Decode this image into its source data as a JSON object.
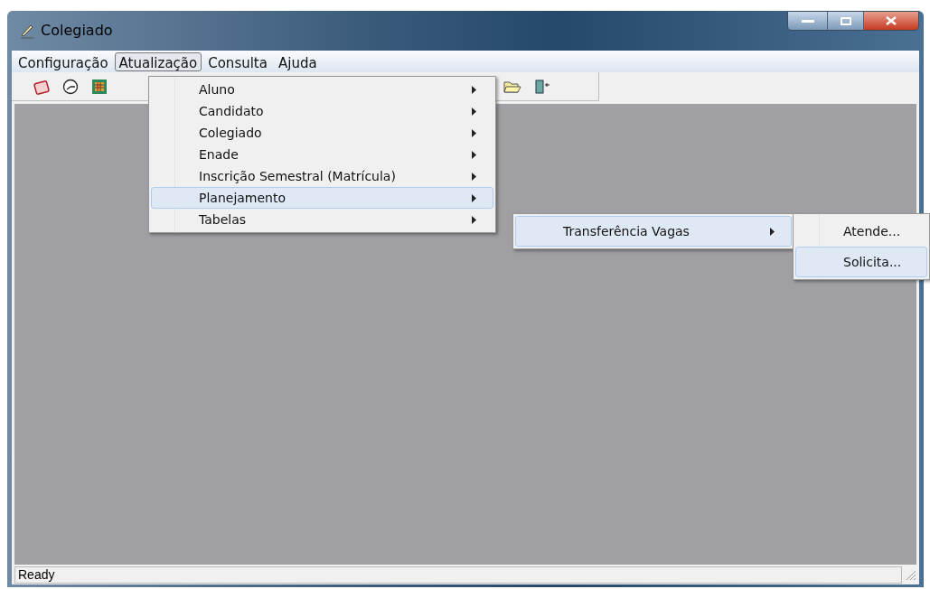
{
  "window": {
    "title": "Colegiado"
  },
  "menu_bar": [
    {
      "label": "Configuração",
      "selected": false
    },
    {
      "label": "Atualização",
      "selected": true
    },
    {
      "label": "Consulta",
      "selected": false
    },
    {
      "label": "Ajuda",
      "selected": false
    }
  ],
  "menu": {
    "items": [
      {
        "label": "Aluno",
        "submenu": true,
        "selected": false
      },
      {
        "label": "Candidato",
        "submenu": true,
        "selected": false
      },
      {
        "label": "Colegiado",
        "submenu": true,
        "selected": false
      },
      {
        "label": "Enade",
        "submenu": true,
        "selected": false
      },
      {
        "label": "Inscrição Semestral (Matrícula)",
        "submenu": true,
        "selected": false
      },
      {
        "label": "Planejamento",
        "submenu": true,
        "selected": true
      },
      {
        "label": "Tabelas",
        "submenu": true,
        "selected": false
      }
    ]
  },
  "submenu": {
    "items": [
      {
        "label": "Transferência Vagas",
        "submenu": true,
        "selected": true
      }
    ]
  },
  "submenu_2": {
    "items": [
      {
        "label": "Atende...",
        "submenu": false,
        "selected": false
      },
      {
        "label": "Solicita...",
        "submenu": false,
        "selected": true
      }
    ]
  },
  "status_bar": {
    "text": "Ready"
  }
}
